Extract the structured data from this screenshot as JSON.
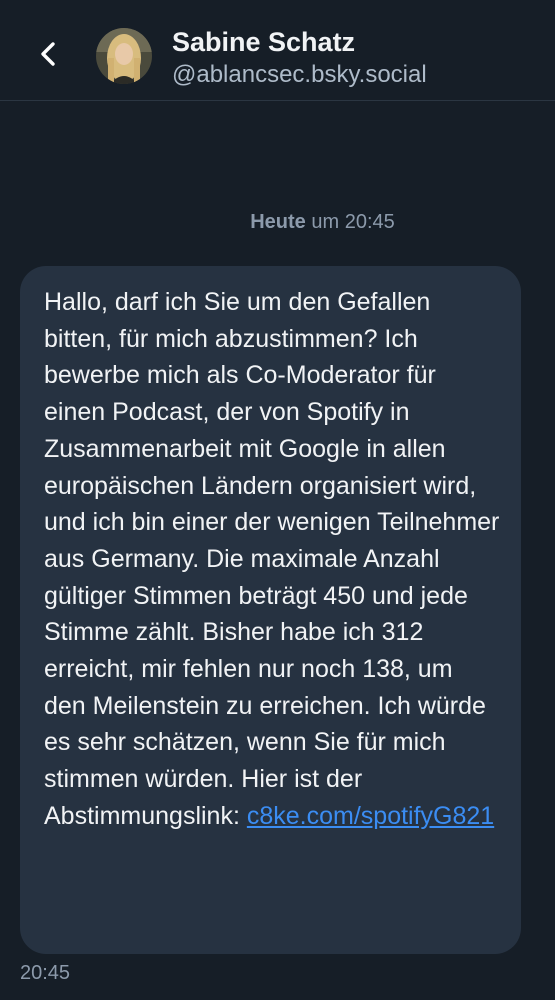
{
  "header": {
    "back_icon": "chevron-left-icon",
    "name": "Sabine Schatz",
    "handle": "@ablancsec.bsky.social"
  },
  "thread": {
    "date_day": "Heute",
    "date_time": "um 20:45"
  },
  "message": {
    "text": "Hallo, darf ich Sie um den Gefallen bitten, für mich abzustimmen? Ich bewerbe mich als Co-Moderator für einen Podcast, der von Spotify in Zusammenarbeit mit Google in allen europäischen Ländern organisiert wird, und ich bin einer der wenigen Teilnehmer aus Germany. Die maximale Anzahl gültiger Stimmen beträgt 450 und jede Stimme zählt. Bisher habe ich 312 erreicht, mir fehlen nur noch 138, um den Meilenstein zu erreichen. Ich würde es sehr schätzen, wenn Sie für mich stimmen würden. Hier ist der Abstimmungslink: ",
    "link": "c8ke.com/spotifyG821",
    "time": "20:45"
  },
  "colors": {
    "background": "#161e27",
    "bubble": "#263241",
    "link": "#3b8df3",
    "muted": "#8c9aab"
  }
}
